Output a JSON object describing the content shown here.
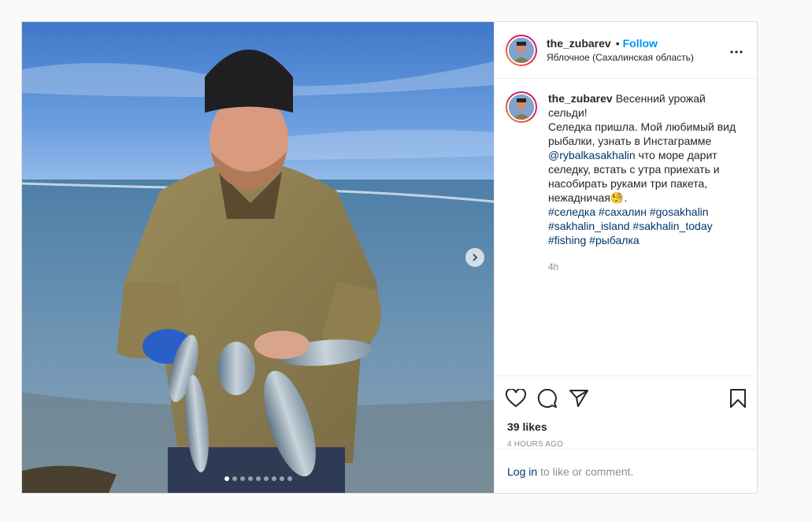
{
  "post": {
    "username": "the_zubarev",
    "follow_label": "Follow",
    "location": "Яблочное (Сахалинская область)",
    "caption": {
      "username": "the_zubarev",
      "text_before_mention": "Весенний урожай сельди!\nСеледка пришла. Мой любимый вид рыбалки, узнать в Инстаграмме ",
      "mention": "@rybalkasakhalin",
      "text_after_mention": " что море дарит селедку, встать с утра приехать и насобирать руками три пакета, нежадничая🧐.",
      "hashtags": [
        "#селедка",
        "#сахалин",
        "#gosakhalin",
        "#sakhalin_island",
        "#sakhalin_today",
        "#fishing",
        "#рыбалка"
      ]
    },
    "comment_time": "4h",
    "likes": "39 likes",
    "posted_ago": "4 HOURS AGO",
    "login_link": "Log in",
    "login_suffix": "to like or comment.",
    "carousel": {
      "slides": 9,
      "active": 1
    }
  },
  "icons": {
    "more": "more-options-icon",
    "like": "heart-icon",
    "comment": "comment-icon",
    "share": "share-icon",
    "save": "bookmark-icon",
    "next": "chevron-right-icon"
  },
  "colors": {
    "accent": "#0095f6",
    "link": "#00376b",
    "muted": "#8e8e8e"
  }
}
